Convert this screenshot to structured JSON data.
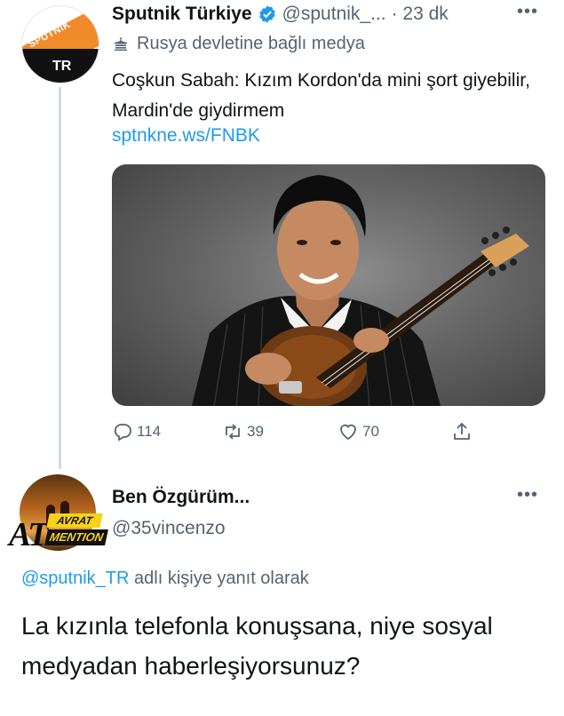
{
  "tweet": {
    "author": {
      "name": "Sputnik Türkiye",
      "handle": "@sputnik_...",
      "time": "· 23 dk",
      "avatar_brand": "SPUTNIK",
      "avatar_region": "TR",
      "verified_icon": "verified-badge-icon"
    },
    "more_icon": "more-options-icon",
    "label": {
      "icon": "state-affiliated-flag-icon",
      "text": "Rusya devletine bağlı medya"
    },
    "text": "Coşkun Sabah: Kızım Kordon'da mini şort giyebilir, Mardin'de giydirmem",
    "link": "sptnkne.ws/FNBK",
    "media_subject": "photo-man-with-oud",
    "actions": {
      "reply": {
        "icon": "reply-icon",
        "count": "114"
      },
      "retweet": {
        "icon": "retweet-icon",
        "count": "39"
      },
      "like": {
        "icon": "heart-icon",
        "count": "70"
      },
      "share": {
        "icon": "share-icon",
        "count": ""
      }
    }
  },
  "reply": {
    "author": {
      "name": "Ben Özgürüm...",
      "handle": "@35vincenzo",
      "badge_main": "AT",
      "badge_top": "AVRAT",
      "badge_bottom": "MENTION"
    },
    "more_icon": "more-options-icon",
    "replying_to_mention": "@sputnik_TR",
    "replying_to_suffix": " adlı kişiye yanıt olarak",
    "text": "La kızınla telefonla konuşsana, niye sosyal medyadan haberleşiyorsunuz?"
  },
  "colors": {
    "accent": "#1d9bf0",
    "secondary_text": "#536471",
    "primary_text": "#0f1419",
    "sputnik_orange": "#f08a2b",
    "thread_line": "#cfd9de"
  }
}
